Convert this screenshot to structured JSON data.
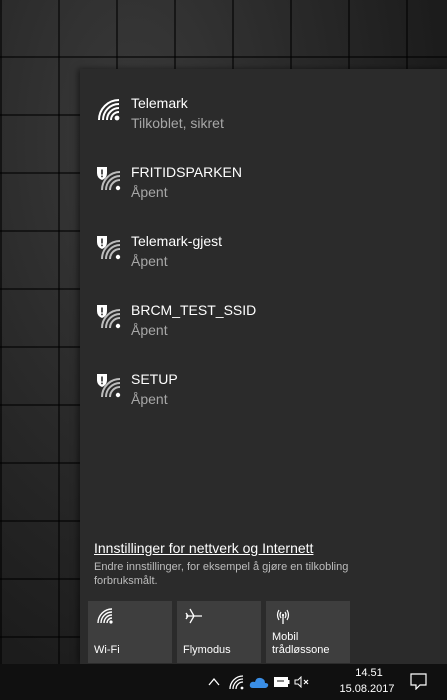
{
  "networks": [
    {
      "name": "Telemark",
      "status": "Tilkoblet, sikret",
      "icon": "wifi-connected-icon"
    },
    {
      "name": "FRITIDSPARKEN",
      "status": "Åpent",
      "icon": "wifi-open-warning-icon"
    },
    {
      "name": "Telemark-gjest",
      "status": "Åpent",
      "icon": "wifi-open-warning-icon"
    },
    {
      "name": "BRCM_TEST_SSID",
      "status": "Åpent",
      "icon": "wifi-open-warning-icon"
    },
    {
      "name": "SETUP",
      "status": "Åpent",
      "icon": "wifi-open-warning-icon"
    }
  ],
  "settings": {
    "link": "Innstillinger for nettverk og Internett",
    "description": "Endre innstillinger, for eksempel å gjøre en tilkobling forbruksmålt."
  },
  "tiles": [
    {
      "label": "Wi-Fi",
      "icon": "wifi-icon"
    },
    {
      "label": "Flymodus",
      "icon": "airplane-icon"
    },
    {
      "label": "Mobil trådløssone",
      "icon": "hotspot-icon"
    }
  ],
  "taskbar": {
    "time": "14.51",
    "date": "15.08.2017",
    "icons": [
      "chevron-up-icon",
      "wifi-icon",
      "onedrive-icon",
      "battery-icon",
      "volume-muted-icon",
      "notification-icon"
    ]
  },
  "colors": {
    "flyout_bg": "#2b2b2b",
    "tile_bg": "#3e3e3e",
    "taskbar_bg": "#101010",
    "onedrive": "#3a8ee6"
  }
}
